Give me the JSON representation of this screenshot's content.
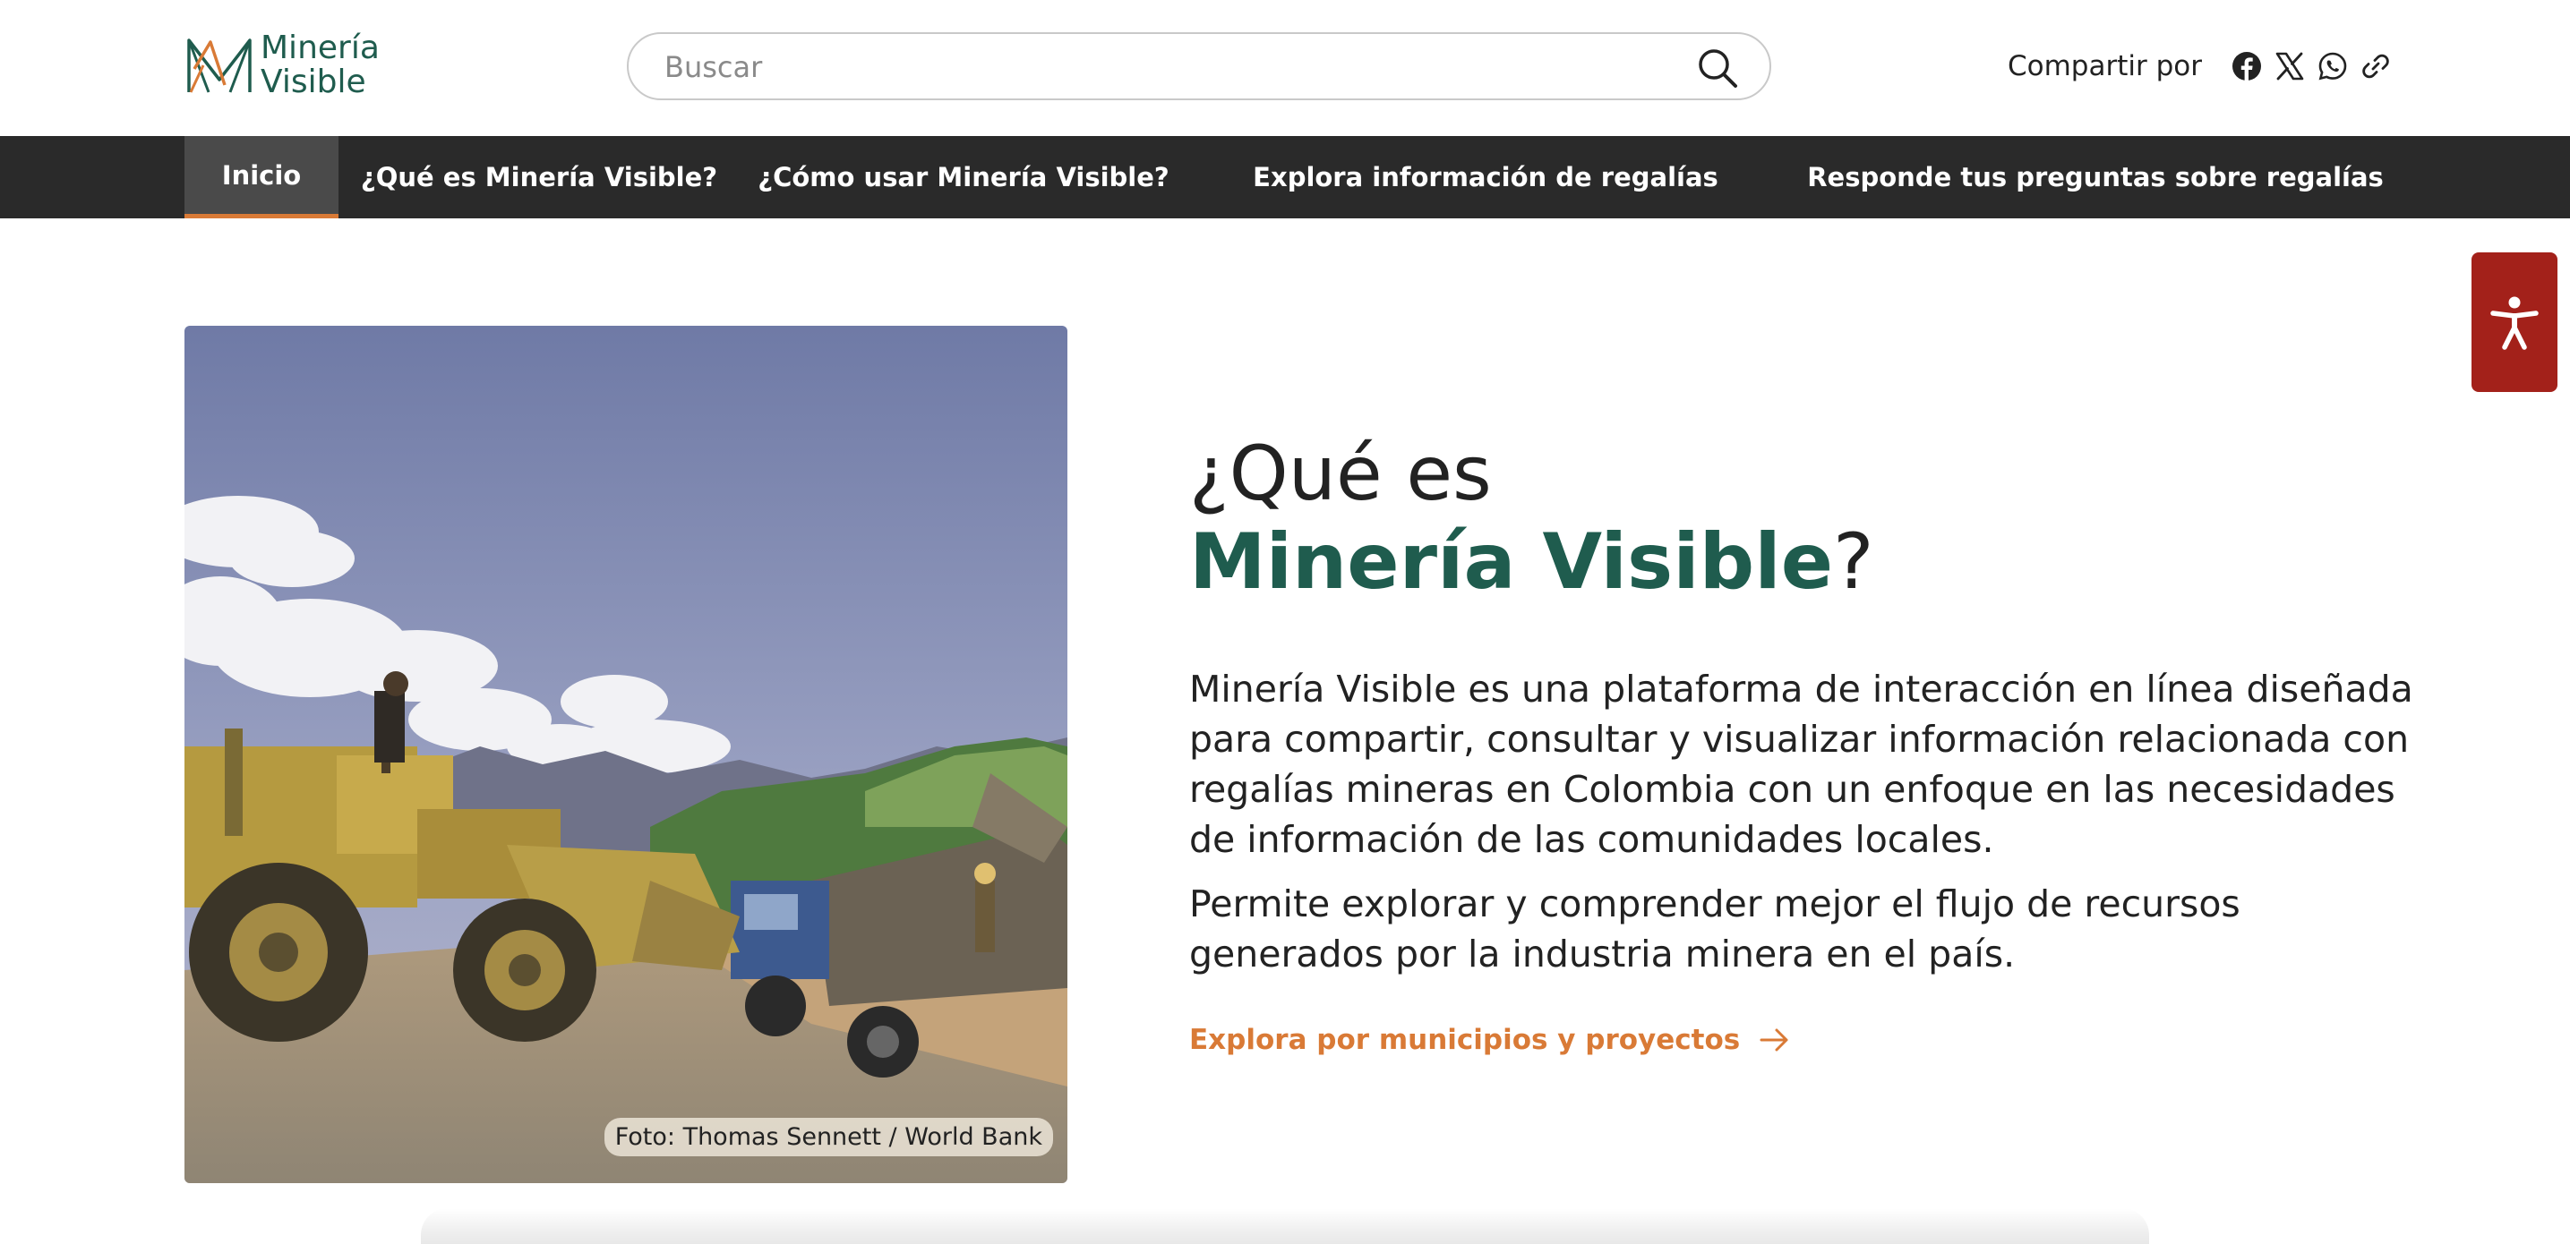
{
  "header": {
    "logo": {
      "line1": "Minería",
      "line2": "Visible"
    },
    "search": {
      "placeholder": "Buscar",
      "value": ""
    },
    "share": {
      "label": "Compartir por",
      "icons": [
        "facebook-icon",
        "x-icon",
        "whatsapp-icon",
        "link-icon"
      ]
    }
  },
  "nav": {
    "items": [
      {
        "label": "Inicio",
        "active": true
      },
      {
        "label": "¿Qué es Minería Visible?"
      },
      {
        "label": "¿Cómo usar Minería Visible?"
      },
      {
        "label": "Explora información de regalías",
        "has_dropdown": true
      },
      {
        "label": "Responde tus preguntas sobre regalías"
      }
    ]
  },
  "hero": {
    "photo_credit": "Foto: Thomas Sennett / World Bank",
    "title_line1": "¿Qué es",
    "title_brand": "Minería Visible",
    "title_suffix": "?",
    "paragraphs": [
      "Minería Visible es una plataforma de interacción en línea diseñada para compartir, consultar y visualizar información relacionada con regalías mineras en Colombia con un enfoque en las necesidades de información de las comunidades locales.",
      "Permite explorar y comprender mejor el flujo de recursos generados por la industria minera en el país."
    ],
    "cta_label": "Explora por municipios y proyectos"
  },
  "colors": {
    "brand_green": "#1f5c4e",
    "accent_orange": "#d97a36",
    "nav_bg": "#2a2a2a",
    "accessibility_red": "#a3211a"
  }
}
